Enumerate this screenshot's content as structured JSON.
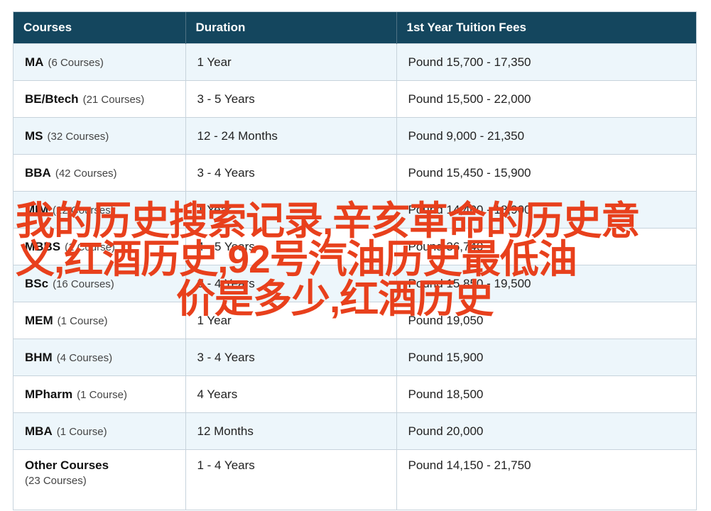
{
  "headers": [
    "Courses",
    "Duration",
    "1st Year Tuition Fees"
  ],
  "rows": [
    {
      "name": "MA",
      "count": "(6 Courses)",
      "duration": "1 Year",
      "fee": "Pound 15,700 - 17,350"
    },
    {
      "name": "BE/Btech",
      "count": "(21 Courses)",
      "duration": "3 - 5 Years",
      "fee": "Pound 15,500 - 22,000"
    },
    {
      "name": "MS",
      "count": "(32 Courses)",
      "duration": "12 - 24 Months",
      "fee": "Pound 9,000 - 21,350"
    },
    {
      "name": "BBA",
      "count": "(42 Courses)",
      "duration": "3 - 4 Years",
      "fee": "Pound 15,450 - 15,900"
    },
    {
      "name": "MIM",
      "count": "(22 Courses)",
      "duration": "1 Year",
      "fee": "Pound 14,400 - 18,900"
    },
    {
      "name": "MBBS",
      "count": "(1 Course)",
      "duration": "4 - 5 Years",
      "fee": "Pound 36,740"
    },
    {
      "name": "BSc",
      "count": "(16 Courses)",
      "duration": "3 - 4 Years",
      "fee": "Pound 15,850 - 19,500"
    },
    {
      "name": "MEM",
      "count": "(1 Course)",
      "duration": "1 Year",
      "fee": "Pound 19,050"
    },
    {
      "name": "BHM",
      "count": "(4 Courses)",
      "duration": "3 - 4 Years",
      "fee": "Pound 15,900"
    },
    {
      "name": "MPharm",
      "count": "(1 Course)",
      "duration": "4 Years",
      "fee": "Pound 18,500"
    },
    {
      "name": "MBA",
      "count": "(1 Course)",
      "duration": "12 Months",
      "fee": "Pound 20,000"
    },
    {
      "name": "Other Courses",
      "count": "(23 Courses)",
      "duration": "1 - 4 Years",
      "fee": "Pound 14,150 - 21,750"
    }
  ],
  "overlay": {
    "line1": "我的历史搜索记录,辛亥革命的历史意",
    "line2": "义,红酒历史,92号汽油历史最低油",
    "line3": "价是多少,红酒历史"
  },
  "colors": {
    "header_bg": "#14465e",
    "row_alt_bg": "#edf6fb",
    "overlay_text": "#e8401c"
  }
}
